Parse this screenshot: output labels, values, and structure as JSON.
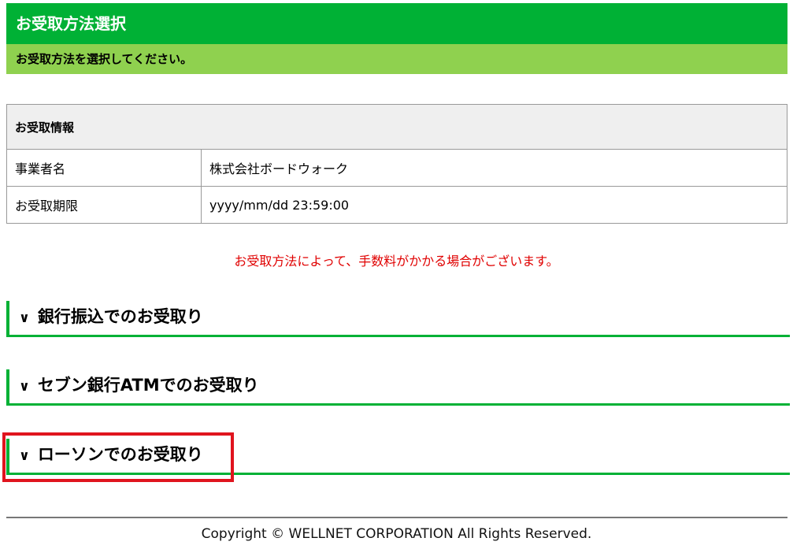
{
  "header": {
    "title": "お受取方法選択",
    "subtitle": "お受取方法を選択してください。"
  },
  "info": {
    "heading": "お受取情報",
    "rows": [
      {
        "label": "事業者名",
        "value": "株式会社ボードウォーク"
      },
      {
        "label": "お受取期限",
        "value": "yyyy/mm/dd 23:59:00"
      }
    ]
  },
  "notice": "お受取方法によって、手数料がかかる場合がございます。",
  "methods": [
    {
      "chevron": "∨",
      "label": "銀行振込でのお受取り"
    },
    {
      "chevron": "∨",
      "label": "セブン銀行ATMでのお受取り"
    },
    {
      "chevron": "∨",
      "label": "ローソンでのお受取り"
    }
  ],
  "footer": {
    "copyright": "Copyright © WELLNET CORPORATION All Rights Reserved."
  },
  "colors": {
    "brand_green": "#00b135",
    "light_green": "#8fd14f",
    "notice_red": "#e00000",
    "highlight_red": "#e0141e"
  }
}
